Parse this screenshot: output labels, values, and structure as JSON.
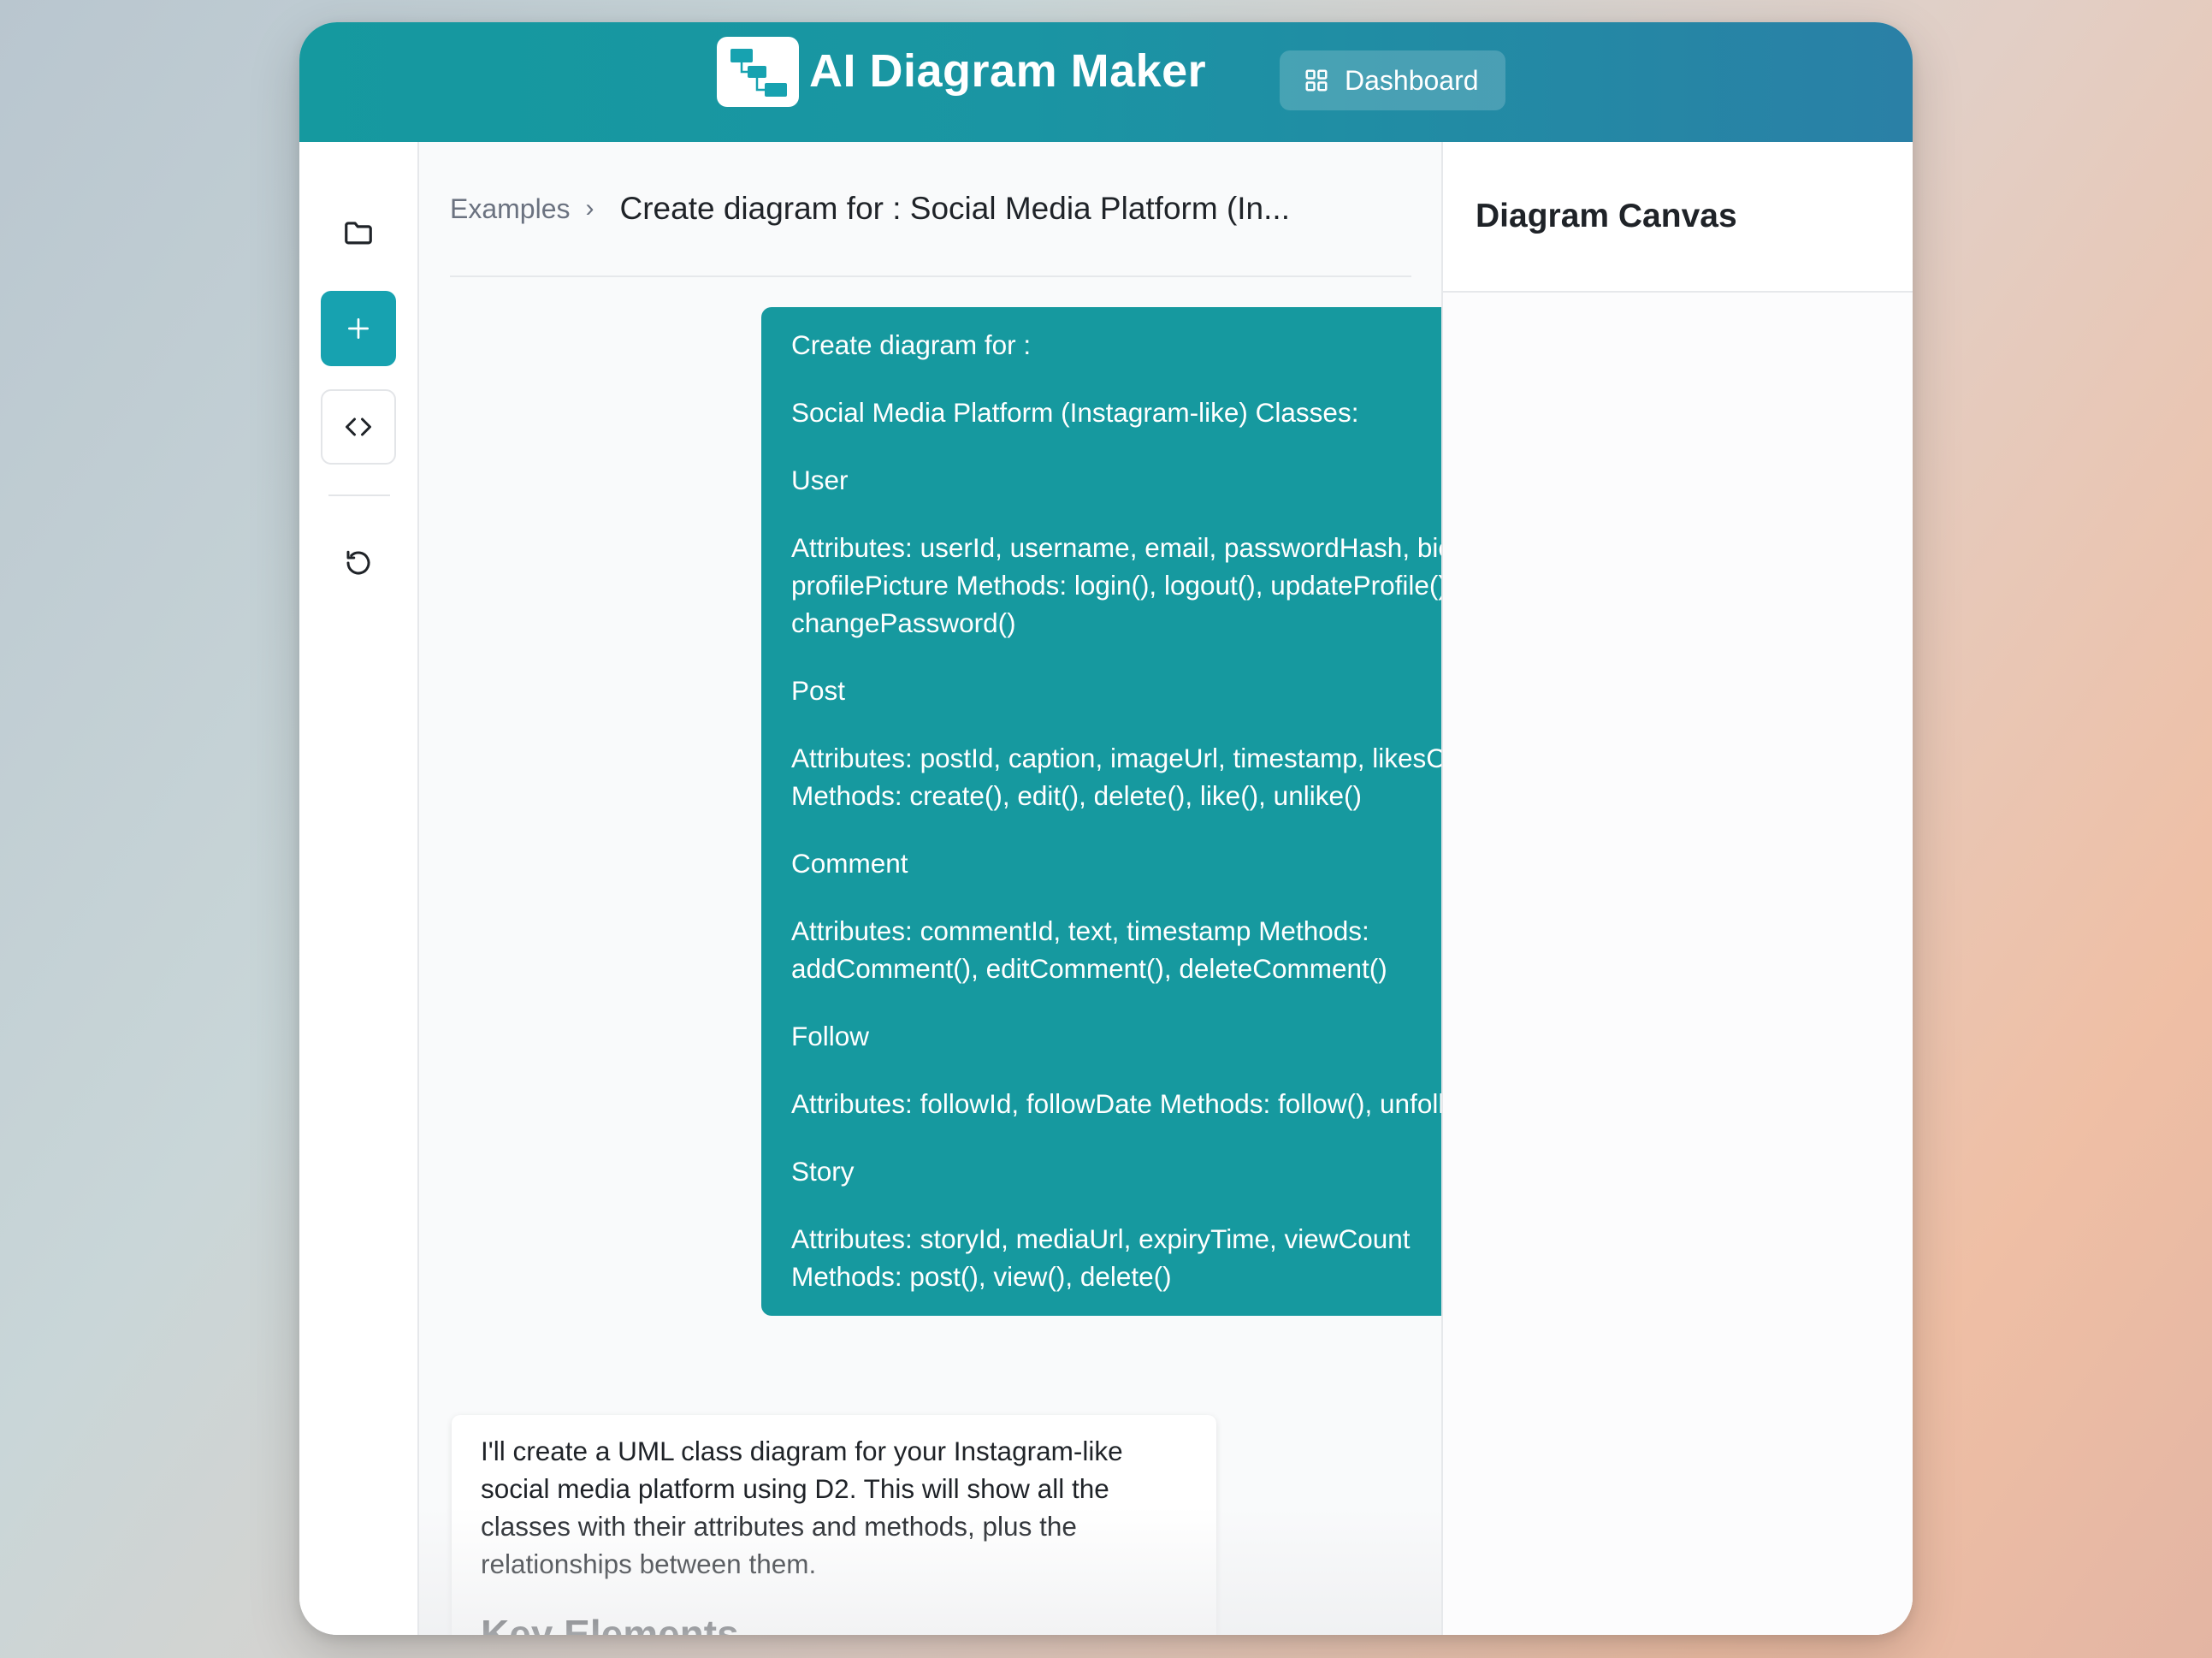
{
  "app": {
    "title": "AI Diagram Maker",
    "dashboard_label": "Dashboard",
    "colors": {
      "brand": "#17a2b0",
      "header_end": "#2a80a6",
      "user_bubble": "#16999f"
    }
  },
  "sidebar": {
    "items": [
      {
        "icon": "folder-icon"
      },
      {
        "icon": "plus-icon",
        "active": true
      },
      {
        "icon": "code-icon"
      },
      {
        "icon": "history-icon"
      }
    ]
  },
  "breadcrumb": {
    "root": "Examples",
    "separator": "›",
    "current": "Create diagram for : Social Media Platform (In..."
  },
  "chat": {
    "user_message": [
      "Create diagram for :",
      "Social Media Platform (Instagram-like) Classes:",
      "User",
      "Attributes: userId, username, email, passwordHash, bio, profilePicture Methods: login(), logout(), updateProfile(), changePassword()",
      "Post",
      "Attributes: postId, caption, imageUrl, timestamp, likesCount Methods: create(), edit(), delete(), like(), unlike()",
      "Comment",
      "Attributes: commentId, text, timestamp Methods: addComment(), editComment(), deleteComment()",
      "Follow",
      "Attributes: followId, followDate Methods: follow(), unfollow()",
      "Story",
      "Attributes: storyId, mediaUrl, expiryTime, viewCount Methods: post(), view(), delete()"
    ],
    "ai_message": {
      "text": "I'll create a UML class diagram for your Instagram-like social media platform using D2. This will show all the classes with their attributes and methods, plus the relationships between them.",
      "heading": "Key Elements"
    }
  },
  "canvas": {
    "title": "Diagram Canvas"
  }
}
